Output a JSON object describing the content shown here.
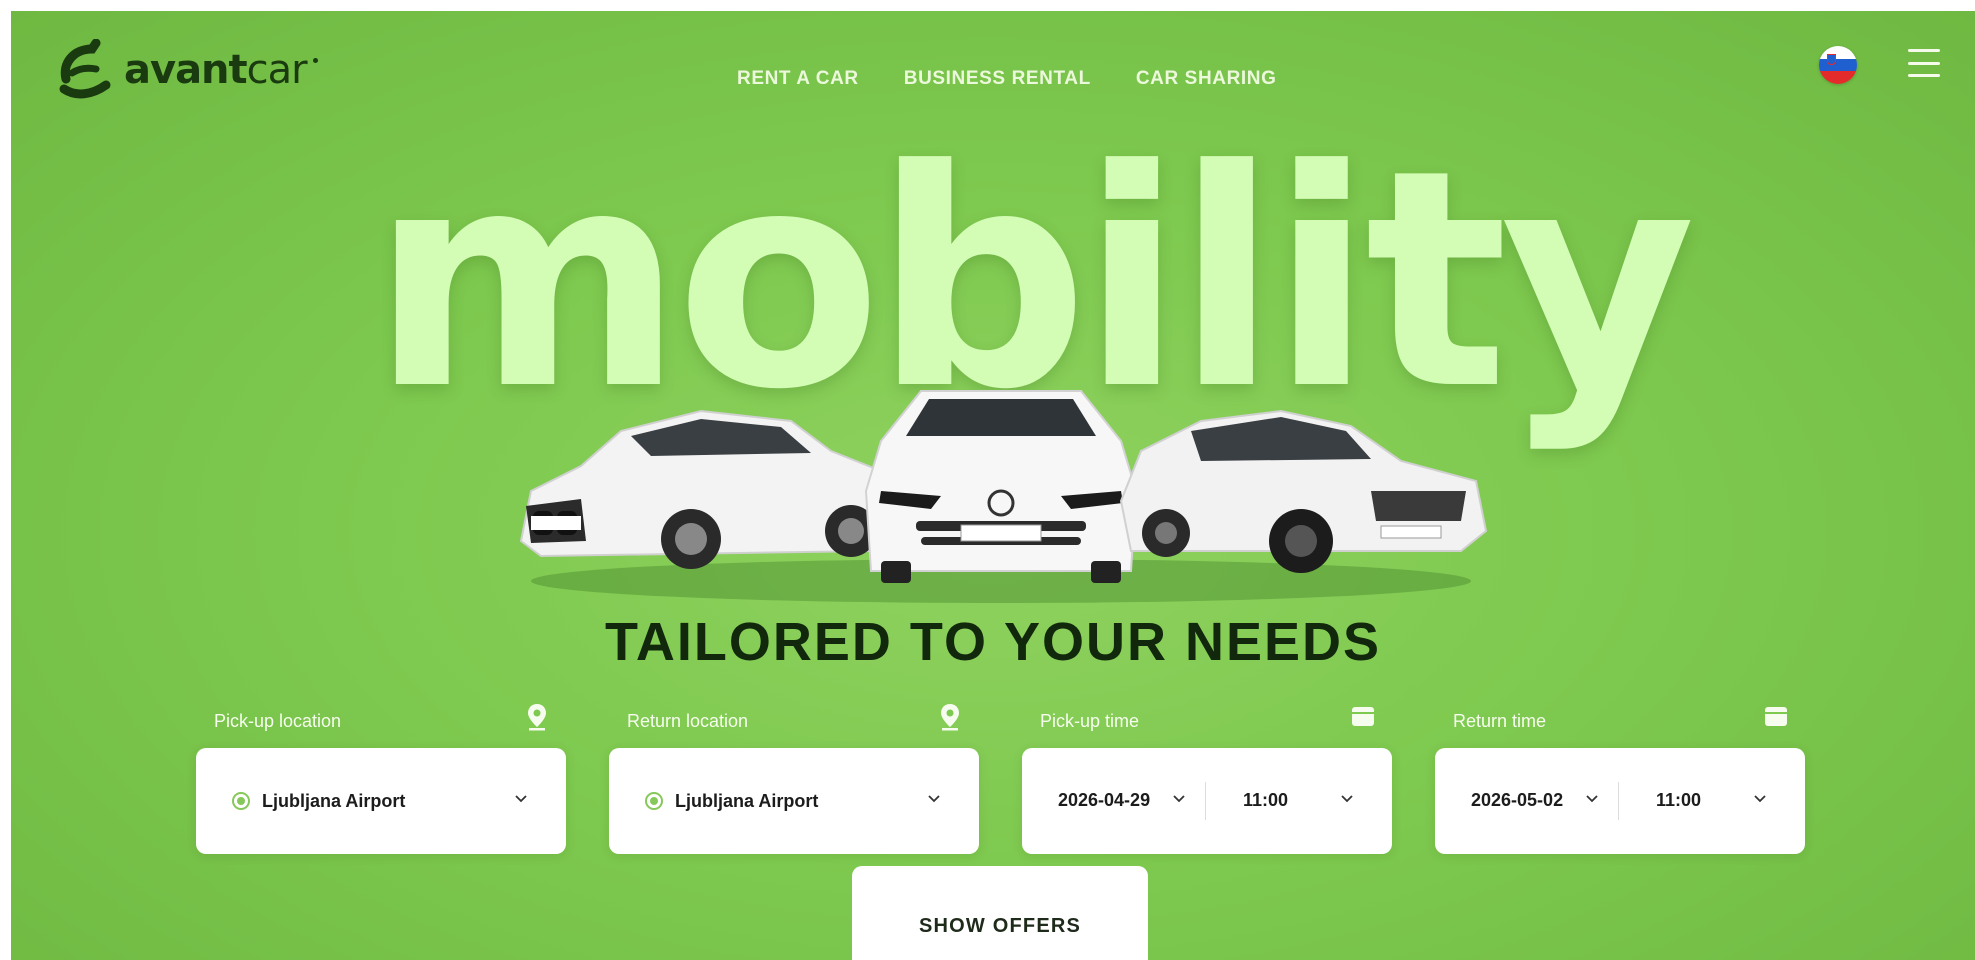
{
  "brand": {
    "name_bold": "avant",
    "name_light": "car"
  },
  "nav": {
    "items": [
      "RENT A CAR",
      "BUSINESS RENTAL",
      "CAR SHARING"
    ]
  },
  "header": {
    "language_flag": "slovenia-flag-icon",
    "menu_icon": "hamburger-menu-icon"
  },
  "hero": {
    "big_word": "mobility",
    "headline": "TAILORED TO YOUR NEEDS"
  },
  "booking": {
    "pickup_location": {
      "label": "Pick-up location",
      "value": "Ljubljana Airport",
      "icon": "location-pin-icon"
    },
    "return_location": {
      "label": "Return location",
      "value": "Ljubljana Airport",
      "icon": "location-pin-icon"
    },
    "pickup_time": {
      "label": "Pick-up time",
      "date": "2026-04-29",
      "time": "11:00",
      "icon": "calendar-icon"
    },
    "return_time": {
      "label": "Return time",
      "date": "2026-05-02",
      "time": "11:00",
      "icon": "calendar-icon"
    },
    "submit_label": "SHOW OFFERS"
  },
  "colors": {
    "hero_green": "#7ec94f",
    "big_word": "#d3fcb5",
    "headline": "#11280c",
    "accent_radio": "#86c95a",
    "logo": "#1a3a10"
  }
}
